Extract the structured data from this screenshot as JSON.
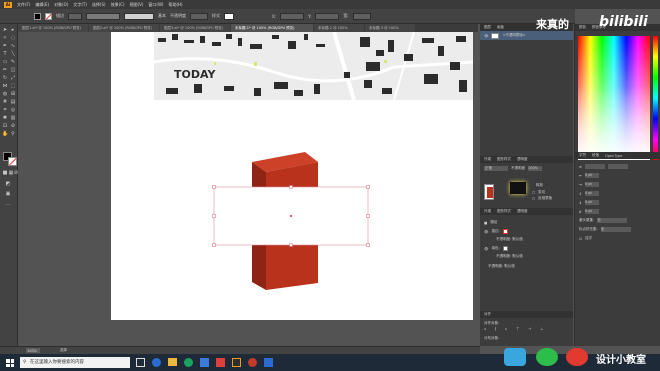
{
  "app": {
    "logo": "Ai"
  },
  "menu": [
    "文件(F)",
    "编辑(E)",
    "对象(O)",
    "文字(T)",
    "选择(S)",
    "效果(C)",
    "视图(V)",
    "窗口(W)",
    "帮助(H)"
  ],
  "control_bar": {
    "fill_color": "#000000",
    "stroke_color": "#ffffff",
    "stroke_label": "描边",
    "stroke_value": "1 pt",
    "style_label": "基本",
    "opacity_label": "不透明度",
    "opacity_value": "100%",
    "style2_label": "样式",
    "x_label": "X:",
    "x_value": "76.563 mm",
    "y_label": "Y:",
    "y_value": "1469 mm",
    "w_label": "宽:",
    "w_value": "0 mm"
  },
  "tabs": [
    {
      "label": "图层1.ai* @ 100% (RGB/GPU 预览)",
      "active": false
    },
    {
      "label": "图层2.ai* @ 100% (RGB/GPU 预览)",
      "active": false
    },
    {
      "label": "图层3.ai* @ 100% (RGB/GPU 预览)",
      "active": false
    },
    {
      "label": "未标题-1* @ 100% (RGB/GPU 预览)",
      "active": true
    },
    {
      "label": "未标题-2 @ 100%",
      "active": false
    },
    {
      "label": "未标题-3 @ 100%",
      "active": false
    }
  ],
  "canvas": {
    "map_title": "TODAY",
    "column_color": "#b8321c",
    "column_shade": "#8f2414",
    "column_top": "#cc4127"
  },
  "status": {
    "zoom": "100%",
    "mode": "选择"
  },
  "layers_panel": {
    "tabs": [
      "图层",
      "画板"
    ],
    "item": "<不透明蒙版>"
  },
  "appearance_panel": {
    "tabs": [
      "外观",
      "图形样式",
      "透明度"
    ],
    "mode": "正常",
    "opacity_label": "不透明度",
    "opacity_value": "100%",
    "make_mask_label": "释放",
    "clip_label": "剪切",
    "invert_label": "反相蒙版",
    "rows": [
      {
        "label": "路径"
      },
      {
        "label": "描边:",
        "value": ""
      },
      {
        "label": "不透明度: 默认值"
      },
      {
        "label": "填色:",
        "value": ""
      },
      {
        "label": "不透明度: 默认值"
      },
      {
        "label": "不透明度: 默认值"
      }
    ]
  },
  "align_panel": {
    "title": "对齐",
    "align_objects": "对齐对象:",
    "distribute_objects": "分布对象:",
    "distribute_spacing": "分布间距:"
  },
  "color_panel": {
    "tabs": [
      "颜色",
      "颜色参考"
    ]
  },
  "char_panel": {
    "tabs": [
      "字符",
      "段落",
      "OpenType"
    ],
    "rows": [
      "0 pt",
      "0 pt",
      "0 pt",
      "0 pt",
      "0 pt"
    ],
    "hyphen_label": "避头尾集:",
    "hyphen_value": "无",
    "punct_label": "标点挤压集:",
    "punct_value": "无",
    "auto_label": "连字"
  },
  "taskbar": {
    "search_placeholder": "在这里输入你要搜索的内容"
  },
  "watermark": {
    "text1": "来真的",
    "text2": "bilibili",
    "footer": "设计小教室"
  }
}
